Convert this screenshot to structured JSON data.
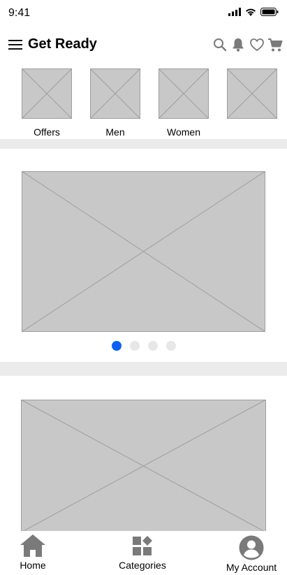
{
  "status_bar": {
    "time": "9:41",
    "icons": [
      "signal-icon",
      "wifi-icon",
      "battery-icon"
    ]
  },
  "header": {
    "title": "Get Ready",
    "actions": [
      "search-icon",
      "bell-icon",
      "heart-icon",
      "cart-icon"
    ]
  },
  "categories": [
    {
      "label": "Offers"
    },
    {
      "label": "Men"
    },
    {
      "label": "Women"
    },
    {
      "label": ""
    }
  ],
  "carousel": {
    "slide_count": 4,
    "active_index": 0
  },
  "bottom_nav": {
    "items": [
      {
        "label": "Home",
        "icon": "home-icon"
      },
      {
        "label": "Categories",
        "icon": "categories-icon"
      },
      {
        "label": "My Account",
        "icon": "account-icon"
      }
    ]
  },
  "colors": {
    "placeholder_fill": "#c8c8c8",
    "placeholder_line": "#9e9e9e",
    "divider": "#ebebeb",
    "active_dot": "#0a60f5",
    "inactive_dot": "#e7e7e7",
    "icon_gray": "#7a7a7a"
  }
}
